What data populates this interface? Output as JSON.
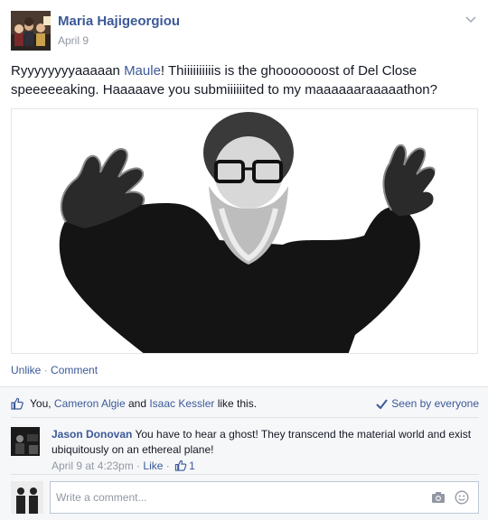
{
  "post": {
    "author": "Maria Hajigeorgiou",
    "date": "April 9",
    "text_before": "Ryyyyyyyyaaaaan ",
    "mention": "Maule",
    "text_after": "! Thiiiiiiiiiis is the ghooooooost of Del Close speeeeeaking. Haaaaave you submiiiiiited to my maaaaaaraaaaathon?",
    "photo_icon": "photo-of-bearded-man"
  },
  "actions": {
    "unlike": "Unlike",
    "separator": " · ",
    "comment": "Comment"
  },
  "likes": {
    "prefix": "You, ",
    "person1": "Cameron Algie",
    "and": " and ",
    "person2": "Isaac Kessler",
    "suffix": " like this.",
    "seen": "Seen by everyone"
  },
  "comment": {
    "author": "Jason Donovan",
    "text": " You have to hear a ghost! They transcend the material world and exist ubiquitously on an ethereal plane!",
    "time": "April 9 at 4:23pm",
    "sep1": " · ",
    "like": "Like",
    "sep2": " · ",
    "like_count": "1"
  },
  "composer": {
    "placeholder": "Write a comment..."
  },
  "colors": {
    "link": "#3b5998",
    "meta": "#9197a3",
    "ufi_background": "#f6f7f9"
  }
}
